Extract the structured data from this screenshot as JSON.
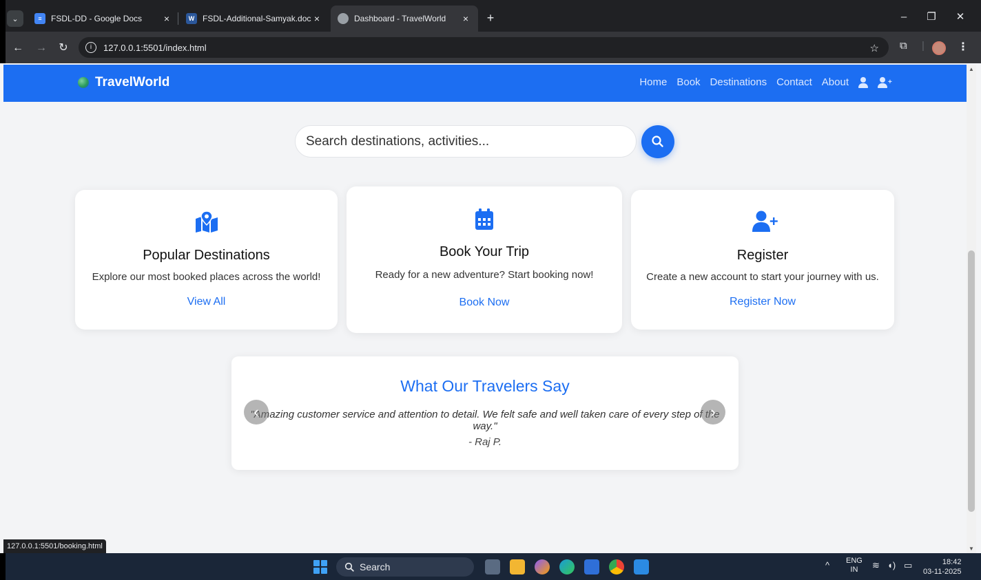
{
  "browser": {
    "tabs": [
      {
        "title": "FSDL-DD - Google Docs",
        "active": false
      },
      {
        "title": "FSDL-Additional-Samyak.docx",
        "active": false
      },
      {
        "title": "Dashboard - TravelWorld",
        "active": true
      }
    ],
    "url": "127.0.0.1:5501/index.html",
    "status_url": "127.0.0.1:5501/booking.html"
  },
  "navbar": {
    "brand": "TravelWorld",
    "links": [
      "Home",
      "Book",
      "Destinations",
      "Contact",
      "About"
    ]
  },
  "search": {
    "placeholder": "Search destinations, activities..."
  },
  "cards": [
    {
      "title": "Popular Destinations",
      "text": "Explore our most booked places across the world!",
      "link": "View All",
      "icon": "map-marked-icon"
    },
    {
      "title": "Book Your Trip",
      "text": "Ready for a new adventure? Start booking now!",
      "link": "Book Now",
      "icon": "calendar-icon"
    },
    {
      "title": "Register",
      "text": "Create a new account to start your journey with us.",
      "link": "Register Now",
      "icon": "user-plus-icon"
    }
  ],
  "testimonials": {
    "heading": "What Our Travelers Say",
    "quote": "\"Amazing customer service and attention to detail. We felt safe and well taken care of every step of the way.\"",
    "author": "- Raj P."
  },
  "taskbar": {
    "search_label": "Search",
    "lang_top": "ENG",
    "lang_bottom": "IN",
    "time": "18:42",
    "date": "03-11-2025"
  },
  "colors": {
    "primary": "#1c6ef2",
    "background": "#f3f4f6"
  }
}
